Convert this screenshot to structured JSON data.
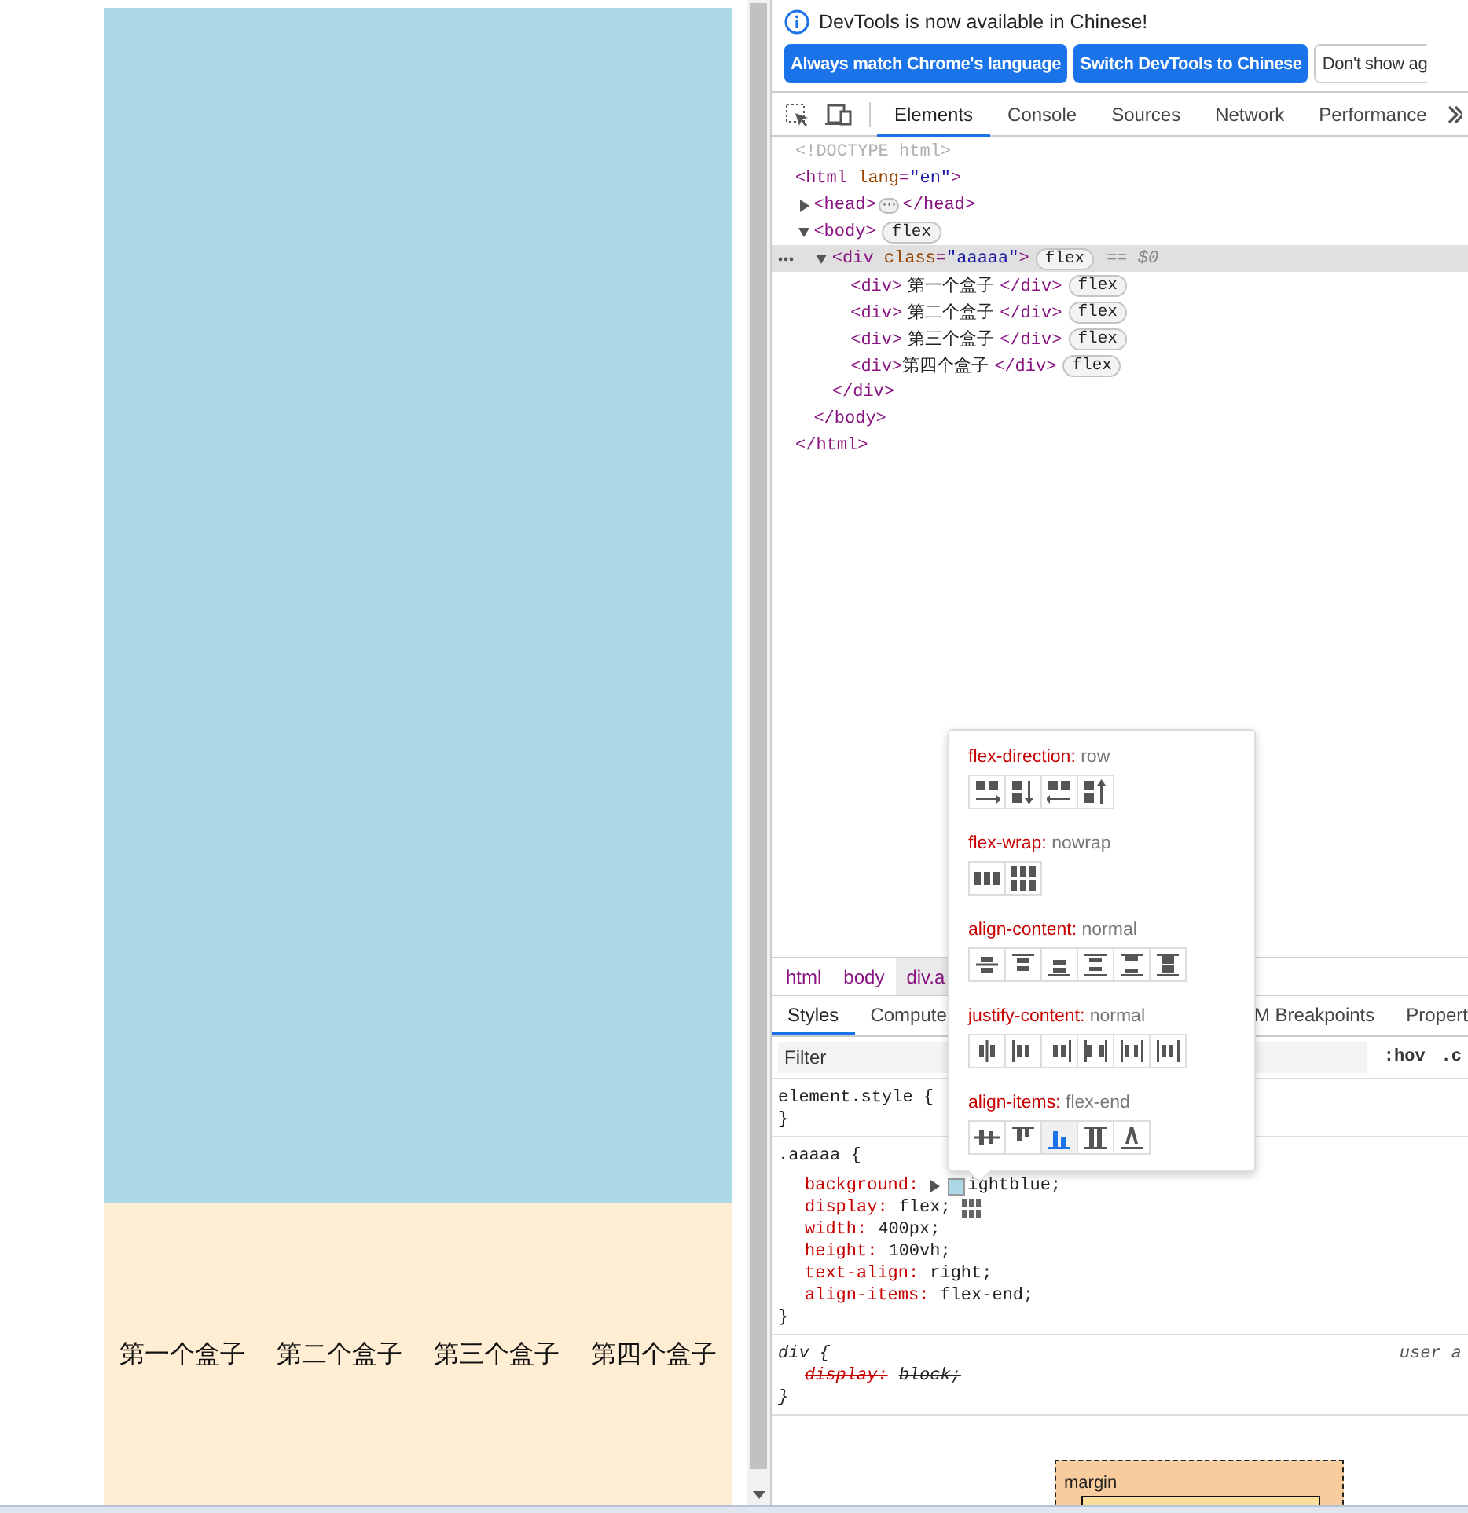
{
  "page": {
    "items": [
      "第一个盒子",
      "第二个盒子",
      "第三个盒子",
      "第四个盒子"
    ]
  },
  "devtools": {
    "notice": {
      "message": "DevTools is now available in Chinese!"
    },
    "notice_buttons": [
      {
        "label": "Always match Chrome's language",
        "kind": "primary"
      },
      {
        "label": "Switch DevTools to Chinese",
        "kind": "primary"
      },
      {
        "label": "Don't show ag",
        "kind": "secondary"
      }
    ],
    "tabs": [
      {
        "label": "Elements",
        "selected": true
      },
      {
        "label": "Console",
        "selected": false
      },
      {
        "label": "Sources",
        "selected": false
      },
      {
        "label": "Network",
        "selected": false
      },
      {
        "label": "Performance",
        "selected": false
      }
    ],
    "dom_tree": [
      {
        "selected": false,
        "line": [
          {
            "kind": "doctype",
            "text": "<!DOCTYPE html>"
          }
        ]
      },
      {
        "selected": false,
        "line": [
          {
            "kind": "tag",
            "text": "<html "
          },
          {
            "kind": "attr",
            "text": "lang"
          },
          {
            "kind": "punct",
            "text": "="
          },
          {
            "kind": "value",
            "text": "\"en\""
          },
          {
            "kind": "tag",
            "text": ">"
          }
        ],
        "close": [
          {
            "kind": "tag",
            "text": "</html>"
          }
        ],
        "children": [
          {
            "selected": false,
            "expanded": false,
            "line": [
              {
                "kind": "tag",
                "text": "<head>"
              },
              {
                "kind": "ellipsis",
                "text": "⋯"
              },
              {
                "kind": "tag",
                "text": "</head>"
              }
            ]
          },
          {
            "selected": false,
            "expanded": true,
            "line": [
              {
                "kind": "tag",
                "text": "<body>"
              },
              {
                "kind": "badge",
                "text": "flex"
              }
            ],
            "close": [
              {
                "kind": "tag",
                "text": "</body>"
              }
            ],
            "children": [
              {
                "selected": true,
                "expanded": true,
                "line": [
                  {
                    "kind": "tag",
                    "text": "<div "
                  },
                  {
                    "kind": "attr",
                    "text": "class"
                  },
                  {
                    "kind": "punct",
                    "text": "="
                  },
                  {
                    "kind": "value",
                    "text": "\"aaaaa\""
                  },
                  {
                    "kind": "tag",
                    "text": ">"
                  },
                  {
                    "kind": "badge",
                    "text": "flex"
                  },
                  {
                    "kind": "ref",
                    "text": "== $0"
                  }
                ],
                "close": [
                  {
                    "kind": "tag",
                    "text": "</div>"
                  }
                ],
                "children": [
                  {
                    "selected": false,
                    "line": [
                      {
                        "kind": "tag",
                        "text": "<div>"
                      },
                      {
                        "kind": "text",
                        "text": " 第一个盒子 "
                      },
                      {
                        "kind": "tag",
                        "text": "</div>"
                      },
                      {
                        "kind": "badge",
                        "text": "flex"
                      }
                    ]
                  },
                  {
                    "selected": false,
                    "line": [
                      {
                        "kind": "tag",
                        "text": "<div>"
                      },
                      {
                        "kind": "text",
                        "text": " 第二个盒子 "
                      },
                      {
                        "kind": "tag",
                        "text": "</div>"
                      },
                      {
                        "kind": "badge",
                        "text": "flex"
                      }
                    ]
                  },
                  {
                    "selected": false,
                    "line": [
                      {
                        "kind": "tag",
                        "text": "<div>"
                      },
                      {
                        "kind": "text",
                        "text": " 第三个盒子 "
                      },
                      {
                        "kind": "tag",
                        "text": "</div>"
                      },
                      {
                        "kind": "badge",
                        "text": "flex"
                      }
                    ]
                  },
                  {
                    "selected": false,
                    "line": [
                      {
                        "kind": "tag",
                        "text": "<div>"
                      },
                      {
                        "kind": "text",
                        "text": "第四个盒子 "
                      },
                      {
                        "kind": "tag",
                        "text": "</div>"
                      },
                      {
                        "kind": "badge",
                        "text": "flex"
                      }
                    ]
                  }
                ]
              }
            ]
          }
        ]
      }
    ],
    "breadcrumbs": [
      {
        "label": "html",
        "selected": false
      },
      {
        "label": "body",
        "selected": false
      },
      {
        "label": "div.a",
        "selected": true
      }
    ],
    "style_tabs": [
      {
        "label": "Styles",
        "selected": true
      },
      {
        "label": "Compute",
        "selected": false
      },
      {
        "label": "M Breakpoints",
        "selected": false
      },
      {
        "label": "Propert",
        "selected": false
      }
    ],
    "filter": {
      "placeholder": "Filter"
    },
    "filter_buttons": [
      ":hov",
      ".c"
    ],
    "rules": [
      {
        "kind": "author",
        "selector": "element.style {",
        "close": "}"
      },
      {
        "kind": "author",
        "selector": ".aaaaa {",
        "close": "}",
        "declarations": [
          {
            "name": "background:",
            "value": "ightblue;",
            "kind": "color",
            "color": "#add8e6",
            "overridden": false
          },
          {
            "name": "display:",
            "value": "flex;",
            "kind": "flex",
            "overridden": false
          },
          {
            "name": "width:",
            "value": "400px;",
            "kind": "plain",
            "overridden": false
          },
          {
            "name": "height:",
            "value": "100vh;",
            "kind": "plain",
            "overridden": false
          },
          {
            "name": "text-align:",
            "value": "right;",
            "kind": "plain",
            "overridden": false
          },
          {
            "name": "align-items:",
            "value": "flex-end;",
            "kind": "plain",
            "overridden": false
          }
        ]
      },
      {
        "kind": "user-agent",
        "selector": "div {",
        "origin": "user a",
        "close": "}",
        "declarations": [
          {
            "name": "display:",
            "value": "block;",
            "kind": "plain",
            "overridden": true
          }
        ]
      }
    ],
    "box_model": {
      "label": "margin"
    },
    "flexbox_editor": {
      "sections": [
        {
          "property": "flex-direction:",
          "value": "row",
          "options": [
            {
              "selected": false
            },
            {
              "selected": false
            },
            {
              "selected": false
            },
            {
              "selected": false
            }
          ]
        },
        {
          "property": "flex-wrap:",
          "value": "nowrap",
          "options": [
            {
              "selected": false
            },
            {
              "selected": false
            }
          ]
        },
        {
          "property": "align-content:",
          "value": "normal",
          "options": [
            {
              "selected": false
            },
            {
              "selected": false
            },
            {
              "selected": false
            },
            {
              "selected": false
            },
            {
              "selected": false
            },
            {
              "selected": false
            }
          ]
        },
        {
          "property": "justify-content:",
          "value": "normal",
          "options": [
            {
              "selected": false
            },
            {
              "selected": false
            },
            {
              "selected": false
            },
            {
              "selected": false
            },
            {
              "selected": false
            },
            {
              "selected": false
            }
          ]
        },
        {
          "property": "align-items:",
          "value": "flex-end",
          "options": [
            {
              "selected": false
            },
            {
              "selected": false
            },
            {
              "selected": true
            },
            {
              "selected": false
            },
            {
              "selected": false
            }
          ]
        }
      ]
    }
  }
}
